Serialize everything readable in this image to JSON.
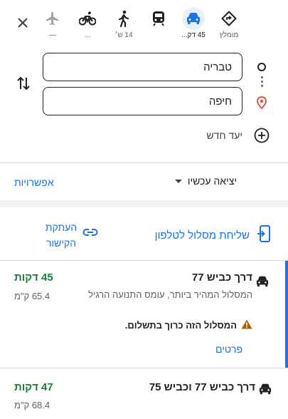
{
  "modes": [
    {
      "id": "best",
      "label": "מומלץ",
      "icon": "diamond-route-icon"
    },
    {
      "id": "driving",
      "label": "45 דק...",
      "icon": "car-icon"
    },
    {
      "id": "transit",
      "label": "",
      "icon": "train-icon"
    },
    {
      "id": "walking",
      "label": "14 ש׳",
      "icon": "walking-icon"
    },
    {
      "id": "cycling",
      "label": "...",
      "icon": "bicycle-icon"
    },
    {
      "id": "flights",
      "label": "—",
      "icon": "airplane-icon"
    }
  ],
  "selected_mode": "driving",
  "search": {
    "origin": "טבריה",
    "destination": "חיפה"
  },
  "add_destination_label": "יעד חדש",
  "depart_label": "יציאה עכשיו",
  "options_label": "אפשרויות",
  "send_to_phone_label": "שליחת מסלול לטלפון",
  "copy_link_label": "העתקת הקישור",
  "routes": [
    {
      "name": "דרך כביש 77",
      "time": "45 דקות",
      "distance": "65.4 ק\"מ",
      "description": "המסלול המהיר ביותר, עומס התנועה הרגיל",
      "warning": "המסלול הזה כרוך בתשלום.",
      "details_label": "פרטים"
    },
    {
      "name": "דרך כביש 77 וכביש 75",
      "time": "47 דקות",
      "distance": "68.4 ק\"מ"
    }
  ],
  "colors": {
    "accent": "#1a73e8",
    "time_green": "#188038",
    "warning": "#b06000",
    "pin_red": "#ea4335"
  }
}
